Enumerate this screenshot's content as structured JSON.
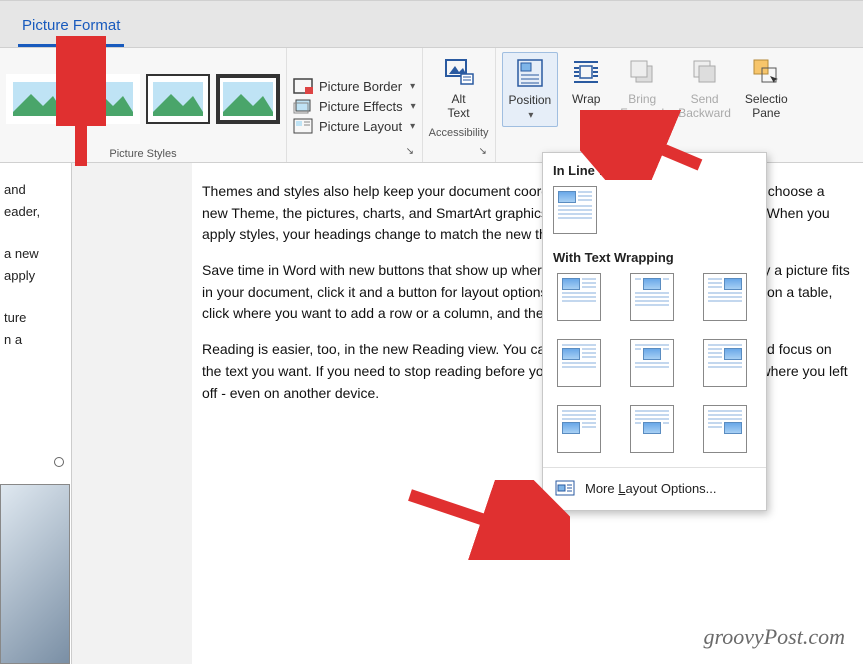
{
  "tab": {
    "label": "Picture Format"
  },
  "ribbon": {
    "picture_styles_label": "Picture Styles",
    "border_menu": {
      "border": "Picture Border",
      "effects": "Picture Effects",
      "layout": "Picture Layout"
    },
    "accessibility_label": "Accessibility",
    "alt_text": "Alt\nText",
    "position": "Position",
    "wrap_text": "Wrap",
    "bring_forward": "Bring\nForward",
    "send_backward": "Send\nBackward",
    "selection_pane": "Selectio\nPane"
  },
  "dropdown": {
    "section1": "In Line with Text",
    "section2": "With Text Wrapping",
    "more": "More Layout Options..."
  },
  "document": {
    "p1": "Themes and styles also help keep your document coordinated. When you click Design and choose a new Theme, the pictures, charts, and SmartArt graphics change to match your new theme. When you apply styles, your headings change to match the new theme.",
    "p2": "Save time in Word with new buttons that show up where you need them. To change the way a picture fits in your document, click it and a button for layout options appears next to it. When you work on a table, click where you want to add a row or a column, and then click the plus sign.",
    "p3": "Reading is easier, too, in the new Reading view. You can collapse parts of the document and focus on the text you want. If you need to stop reading before you reach the end, Word remembers where you left off - even on another device."
  },
  "left_frag": {
    "l1": "and",
    "l2": "eader,",
    "l3": "a new",
    "l4": "apply",
    "l5": "ture",
    "l6": "n a"
  },
  "watermark": "groovyPost.com"
}
